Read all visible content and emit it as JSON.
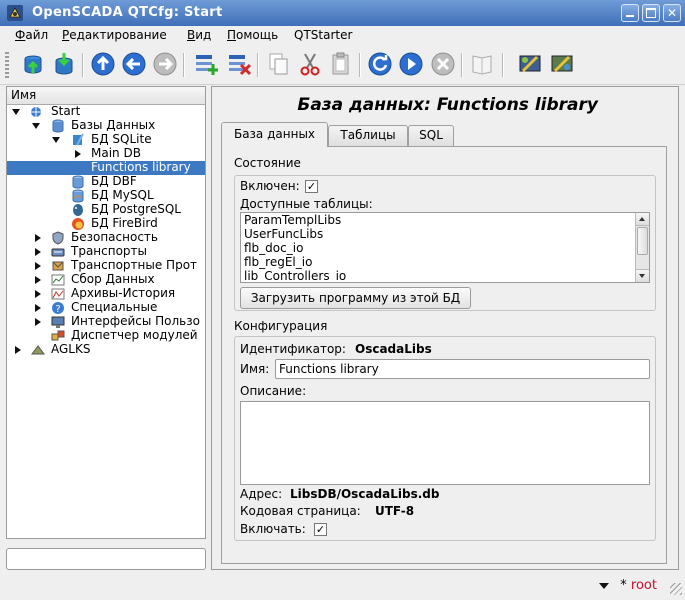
{
  "window": {
    "title": "OpenSCADA QTCfg: Start"
  },
  "menu": {
    "items": [
      {
        "label": "Файл",
        "accel": "Ф",
        "rest": "айл"
      },
      {
        "label": "Редактирование",
        "accel": "Р",
        "rest": "едактирование"
      },
      {
        "label": "Вид",
        "accel": "В",
        "rest": "ид"
      },
      {
        "label": "Помощь",
        "accel": "П",
        "rest": "омощь"
      },
      {
        "label": "QTStarter"
      }
    ]
  },
  "toolbar": {
    "icons": [
      "db-load-icon",
      "db-save-icon",
      "up-icon",
      "back-icon",
      "forward-icon",
      "add-item-icon",
      "delete-item-icon",
      "copy-icon",
      "cut-icon",
      "paste-icon",
      "refresh-icon",
      "start-icon",
      "stop-icon",
      "about-icon",
      "qtcfg-icon",
      "vision-icon"
    ]
  },
  "tree": {
    "header": "Имя",
    "items": [
      {
        "label": "Start"
      },
      {
        "label": "Базы Данных"
      },
      {
        "label": "БД SQLite"
      },
      {
        "label": "Main DB"
      },
      {
        "label": "Functions library"
      },
      {
        "label": "БД DBF"
      },
      {
        "label": "БД MySQL"
      },
      {
        "label": "БД PostgreSQL"
      },
      {
        "label": "БД FireBird"
      },
      {
        "label": "Безопасность"
      },
      {
        "label": "Транспорты"
      },
      {
        "label": "Транспортные Прот"
      },
      {
        "label": "Сбор Данных"
      },
      {
        "label": "Архивы-История"
      },
      {
        "label": "Специальные"
      },
      {
        "label": "Интерфейсы Пользо"
      },
      {
        "label": "Диспетчер модулей"
      },
      {
        "label": "AGLKS"
      }
    ]
  },
  "main": {
    "title": "База данных: Functions library",
    "tabs": [
      {
        "label": "База данных"
      },
      {
        "label": "Таблицы"
      },
      {
        "label": "SQL"
      }
    ],
    "state": {
      "title": "Состояние",
      "enabled_label": "Включен:",
      "enabled_check": "✓",
      "tables_label": "Доступные таблицы:",
      "tables": [
        "ParamTemplLibs",
        "UserFuncLibs",
        "flb_doc_io",
        "flb_regEl_io",
        "lib_Controllers_io"
      ],
      "load_button": "Загрузить программу из этой БД"
    },
    "config": {
      "title": "Конфигурация",
      "id_label": "Идентификатор:",
      "id_value": "OscadaLibs",
      "name_label": "Имя:",
      "name_value": "Functions library",
      "descr_label": "Описание:",
      "addr_label": "Адрес:",
      "addr_value": "LibsDB/OscadaLibs.db",
      "codepage_label": "Кодовая страница:",
      "codepage_value": "UTF-8",
      "enable_label": "Включать:",
      "enable_check": "✓"
    }
  },
  "status": {
    "user_prefix": "*",
    "user": "root"
  }
}
